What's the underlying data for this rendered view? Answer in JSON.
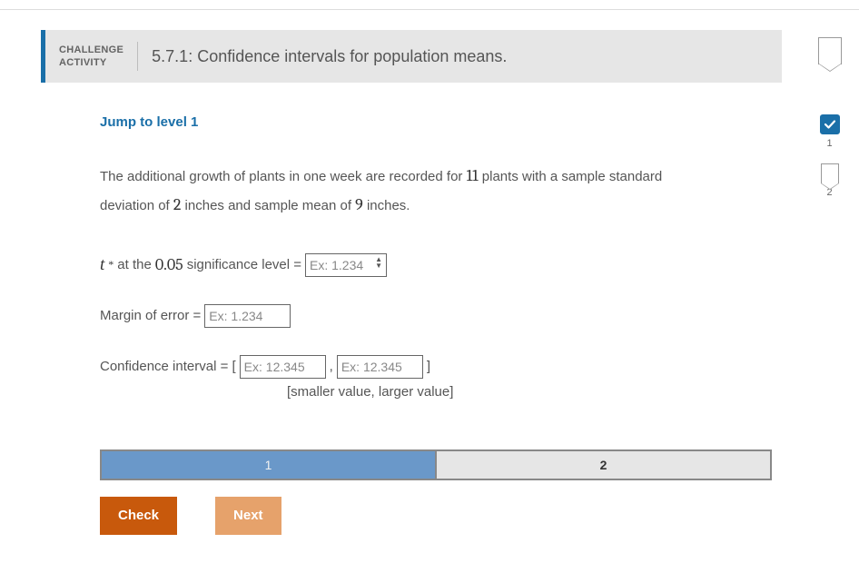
{
  "header": {
    "challenge_line1": "CHALLENGE",
    "challenge_line2": "ACTIVITY",
    "title": "5.7.1: Confidence intervals for population means."
  },
  "content": {
    "jump_link": "Jump to level 1",
    "problem": {
      "text_pre": "The additional growth of plants in one week are recorded for ",
      "n": "11",
      "text_mid": " plants with a sample standard deviation of ",
      "sd": "2",
      "text_mid2": " inches and sample mean of ",
      "mean": "9",
      "text_post": " inches."
    },
    "q1": {
      "t_sym": "t",
      "t_sup": "*",
      "text_pre": " at the ",
      "sig": "0.05",
      "text_post": " significance level = ",
      "placeholder": "Ex: 1.234"
    },
    "q2": {
      "label": "Margin of error = ",
      "placeholder": "Ex: 1.234"
    },
    "q3": {
      "label": "Confidence interval = [",
      "placeholder1": "Ex: 12.345",
      "sep": ",",
      "placeholder2": "Ex: 12.345",
      "close": "]",
      "hint": "[smaller value, larger value]"
    }
  },
  "progress": {
    "seg1": "1",
    "seg2": "2"
  },
  "buttons": {
    "check": "Check",
    "next": "Next"
  },
  "side": {
    "status1_label": "1",
    "status2_label": "2"
  }
}
